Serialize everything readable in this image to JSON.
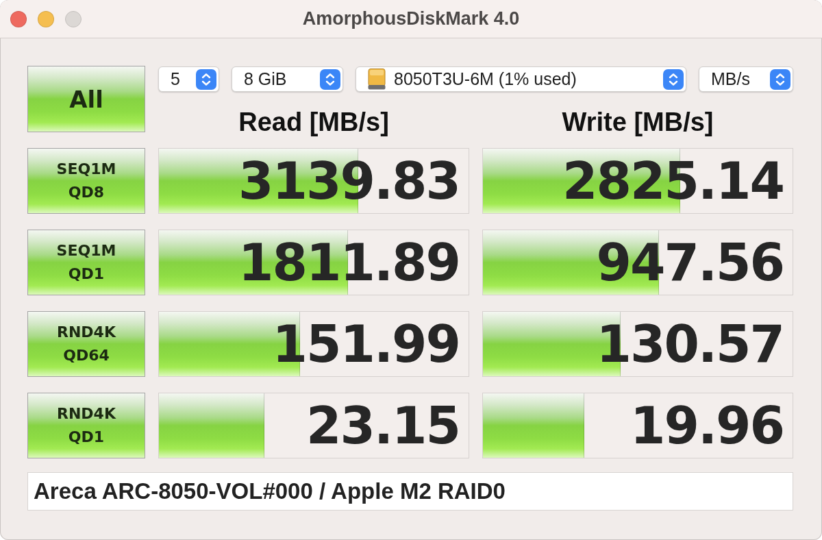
{
  "window": {
    "title": "AmorphousDiskMark 4.0",
    "controls": [
      {
        "kind": "close",
        "disabled": false
      },
      {
        "kind": "minimize",
        "disabled": false
      },
      {
        "kind": "zoom",
        "disabled": true
      }
    ]
  },
  "all_button": {
    "label": "All"
  },
  "selectors": [
    {
      "kind": "count",
      "value": "5"
    },
    {
      "kind": "size",
      "value": "8 GiB"
    },
    {
      "kind": "drive",
      "value": "8050T3U-6M (1% used)"
    },
    {
      "kind": "unit",
      "value": "MB/s"
    }
  ],
  "headers": [
    "Read [MB/s]",
    "Write [MB/s]"
  ],
  "tests": [
    {
      "name": "SEQ1M",
      "queue": "QD8",
      "read": {
        "value": "3139.83",
        "level": 0.643
      },
      "write": {
        "value": "2825.14",
        "level": 0.637
      }
    },
    {
      "name": "SEQ1M",
      "queue": "QD1",
      "read": {
        "value": "1811.89",
        "level": 0.61
      },
      "write": {
        "value": "947.56",
        "level": 0.568
      }
    },
    {
      "name": "RND4K",
      "queue": "QD64",
      "read": {
        "value": "151.99",
        "level": 0.456
      },
      "write": {
        "value": "130.57",
        "level": 0.445
      }
    },
    {
      "name": "RND4K",
      "queue": "QD1",
      "read": {
        "value": "23.15",
        "level": 0.341
      },
      "write": {
        "value": "19.96",
        "level": 0.328
      }
    }
  ],
  "comment": {
    "value": "Areca ARC-8050-VOL#000 / Apple M2 RAID0"
  }
}
